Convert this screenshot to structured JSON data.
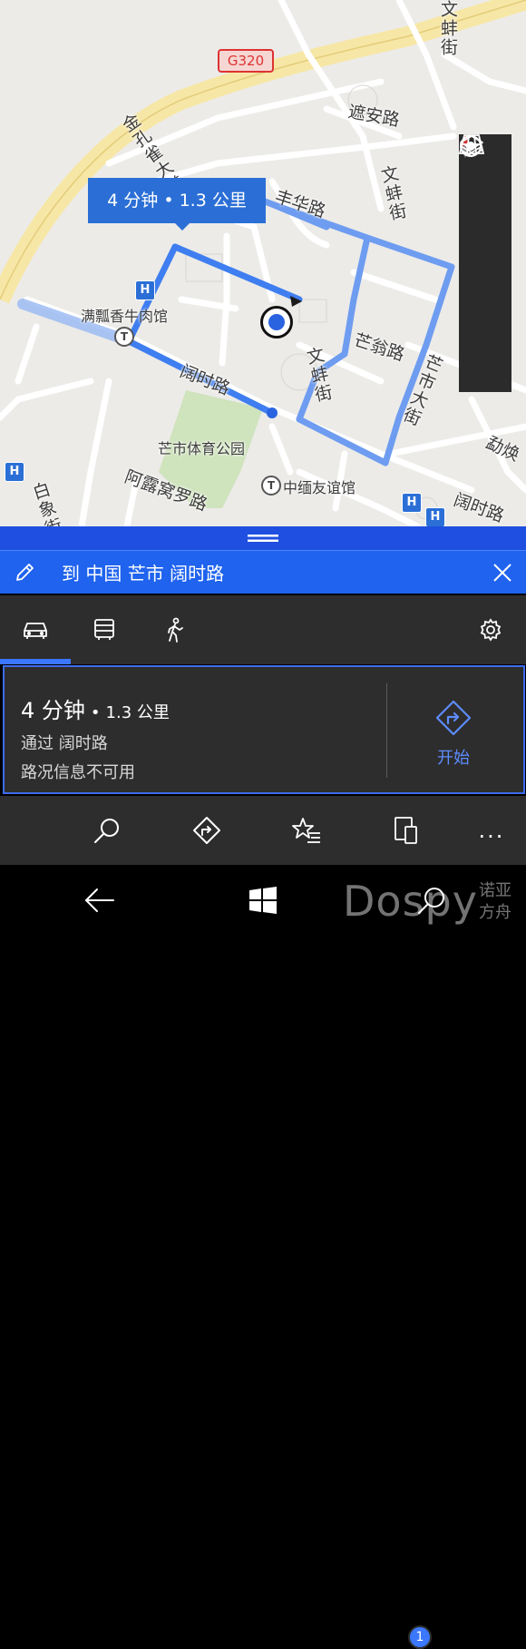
{
  "map": {
    "route_summary": "4 分钟 • 1.3 公里",
    "highway_shield": "G320",
    "labels": {
      "jinkongque": "金孔雀大道",
      "wenbang_top": "文蚌街",
      "zhean": "遮安路",
      "fenghua": "丰华路",
      "wenbang_mid": "文蚌街",
      "wenbang_lower": "文蚌街",
      "mangweng": "芒翁路",
      "mangshi": "芒市大街",
      "kuoshi": "阔时路",
      "kuoshi_right": "阔时路",
      "manpiao": "满瓢香牛肉馆",
      "stadium": "芒市体育公园",
      "aluwoluo": "阿露窝罗路",
      "zhongmian": "中缅友谊馆",
      "baixiang": "白象街",
      "mianhuan": "勐焕"
    },
    "poi_h": "H",
    "poi_t": "T"
  },
  "map_tools": [
    "compass-icon",
    "3d-grid-icon",
    "locate-icon",
    "layers-icon"
  ],
  "destination": {
    "text": "到 中国 芒市 阔时路"
  },
  "modes": [
    "car-icon",
    "bus-icon",
    "walk-icon",
    "settings-icon"
  ],
  "route_card": {
    "time": "4 分钟",
    "separator": "•",
    "distance": "1.3 公里",
    "via": "通过 阔时路",
    "traffic": "路况信息不可用",
    "start_label": "开始"
  },
  "appbar": {
    "icons": [
      "search-icon",
      "directions-icon",
      "favorites-icon",
      "devices-icon",
      "more-icon"
    ],
    "badge_count": "1",
    "more": "..."
  },
  "watermark": {
    "text": "Dospy",
    "cn": "诺亚方舟"
  },
  "colors": {
    "accent": "#1f63ee",
    "route": "#5b8ff0",
    "panel": "#2d2d2d"
  }
}
